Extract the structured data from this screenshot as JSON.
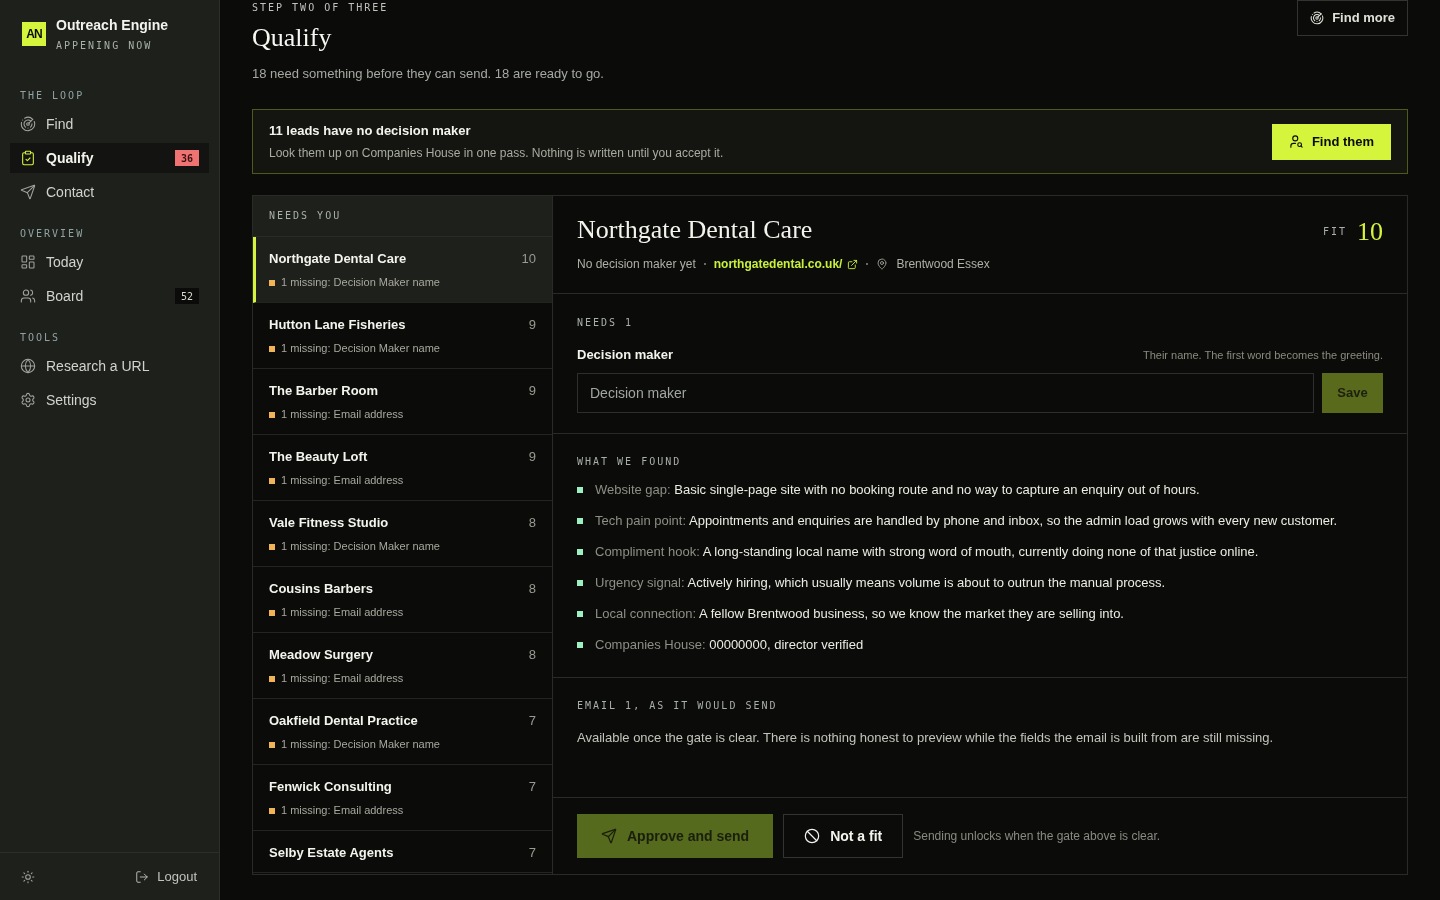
{
  "sidebar": {
    "brand": {
      "logo": "AN",
      "title": "Outreach Engine",
      "subtitle": "APPENING NOW"
    },
    "sections": [
      {
        "label": "THE LOOP",
        "items": [
          {
            "label": "Find",
            "selected": false
          },
          {
            "label": "Qualify",
            "selected": true,
            "badge": {
              "text": "36",
              "kind": "alert"
            }
          },
          {
            "label": "Contact",
            "selected": false
          }
        ]
      },
      {
        "label": "OVERVIEW",
        "items": [
          {
            "label": "Today",
            "selected": false
          },
          {
            "label": "Board",
            "selected": false,
            "badge": {
              "text": "52",
              "kind": "count"
            }
          }
        ]
      },
      {
        "label": "TOOLS",
        "items": [
          {
            "label": "Research a URL",
            "selected": false
          },
          {
            "label": "Settings",
            "selected": false
          }
        ]
      }
    ],
    "logout": "Logout"
  },
  "header": {
    "step": "STEP TWO OF THREE",
    "title": "Qualify",
    "summary": "18 need something before they can send. 18 are ready to go.",
    "action": "Find more"
  },
  "banner": {
    "title": "11 leads have no decision maker",
    "text": "Look them up on Companies House in one pass. Nothing is written until you accept it.",
    "button": "Find them"
  },
  "leads": {
    "heading": "NEEDS YOU",
    "items": [
      {
        "name": "Northgate Dental Care",
        "score": "10",
        "missing": "1 missing: Decision Maker name",
        "selected": true
      },
      {
        "name": "Hutton Lane Fisheries",
        "score": "9",
        "missing": "1 missing: Decision Maker name",
        "selected": false
      },
      {
        "name": "The Barber Room",
        "score": "9",
        "missing": "1 missing: Email address",
        "selected": false
      },
      {
        "name": "The Beauty Loft",
        "score": "9",
        "missing": "1 missing: Email address",
        "selected": false
      },
      {
        "name": "Vale Fitness Studio",
        "score": "8",
        "missing": "1 missing: Decision Maker name",
        "selected": false
      },
      {
        "name": "Cousins Barbers",
        "score": "8",
        "missing": "1 missing: Email address",
        "selected": false
      },
      {
        "name": "Meadow Surgery",
        "score": "8",
        "missing": "1 missing: Email address",
        "selected": false
      },
      {
        "name": "Oakfield Dental Practice",
        "score": "7",
        "missing": "1 missing: Decision Maker name",
        "selected": false
      },
      {
        "name": "Fenwick Consulting",
        "score": "7",
        "missing": "1 missing: Email address",
        "selected": false
      },
      {
        "name": "Selby Estate Agents",
        "score": "7",
        "selected": false
      }
    ]
  },
  "detail": {
    "title": "Northgate Dental Care",
    "status": "No decision maker yet",
    "website": "northgatedental.co.uk/",
    "location": "Brentwood Essex",
    "fit_label": "FIT",
    "fit": "10",
    "needs": {
      "heading": "NEEDS 1",
      "field_label": "Decision maker",
      "hint": "Their name. The first word becomes the greeting.",
      "placeholder": "Decision maker",
      "button": "Save",
      "disabled": true
    },
    "found": {
      "heading": "WHAT WE FOUND",
      "items": [
        {
          "label": "Website gap:",
          "text": "Basic single-page site with no booking route and no way to capture an enquiry out of hours."
        },
        {
          "label": "Tech pain point:",
          "text": "Appointments and enquiries are handled by phone and inbox, so the admin load grows with every new customer."
        },
        {
          "label": "Compliment hook:",
          "text": "A long-standing local name with strong word of mouth, currently doing none of that justice online."
        },
        {
          "label": "Urgency signal:",
          "text": "Actively hiring, which usually means volume is about to outrun the manual process."
        },
        {
          "label": "Local connection:",
          "text": "A fellow Brentwood business, so we know the market they are selling into."
        },
        {
          "label": "Companies House:",
          "text": "00000000, director verified"
        }
      ]
    },
    "email": {
      "heading": "EMAIL 1, AS IT WOULD SEND",
      "text": "Available once the gate is clear. There is nothing honest to preview while the fields the email is built from are still missing."
    },
    "actions": {
      "approve": "Approve and send",
      "approve_disabled": true,
      "reject": "Not a fit",
      "note": "Sending unlocks when the gate above is clear."
    }
  }
}
